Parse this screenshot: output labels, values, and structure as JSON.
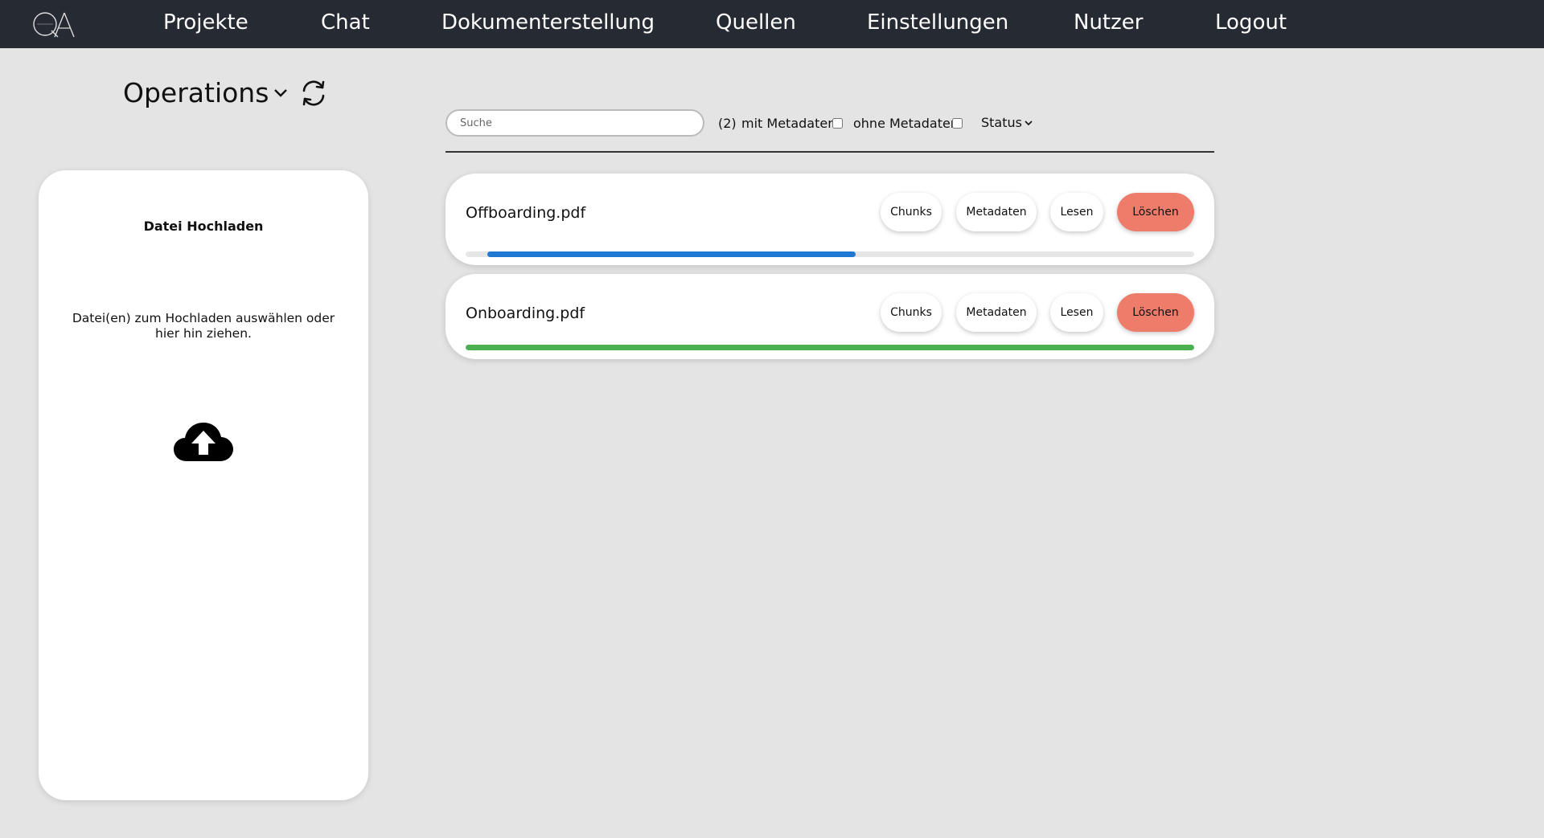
{
  "nav": {
    "items": [
      {
        "label": "Projekte"
      },
      {
        "label": "Chat"
      },
      {
        "label": "Dokumenterstellung"
      },
      {
        "label": "Quellen"
      },
      {
        "label": "Einstellungen"
      },
      {
        "label": "Nutzer"
      },
      {
        "label": "Logout"
      }
    ]
  },
  "project": {
    "selected": "Operations",
    "dropdown_icon": "chevron-down-icon",
    "refresh_icon": "refresh-icon"
  },
  "upload": {
    "title": "Datei Hochladen",
    "hint": "Datei(en) zum Hochladen auswählen oder hier hin ziehen.",
    "icon": "cloud-upload-icon"
  },
  "filters": {
    "search_placeholder": "Suche",
    "count": "(2)",
    "with_metadata": "mit Metadaten",
    "without_metadata": "ohne Metadaten",
    "status": "Status"
  },
  "files": [
    {
      "name": "Offboarding.pdf",
      "buttons": {
        "chunks": "Chunks",
        "metadata": "Metadaten",
        "read": "Lesen",
        "delete": "Löschen"
      },
      "progress_start": 0.03,
      "progress_end": 0.535,
      "progress_color": "#1f78d1"
    },
    {
      "name": "Onboarding.pdf",
      "buttons": {
        "chunks": "Chunks",
        "metadata": "Metadaten",
        "read": "Lesen",
        "delete": "Löschen"
      },
      "progress_start": 0.0,
      "progress_end": 1.0,
      "progress_color": "#4caf50"
    }
  ],
  "colors": {
    "nav_bg": "#262a33",
    "page_bg": "#e4e4e4",
    "delete": "#ee7c6b"
  }
}
